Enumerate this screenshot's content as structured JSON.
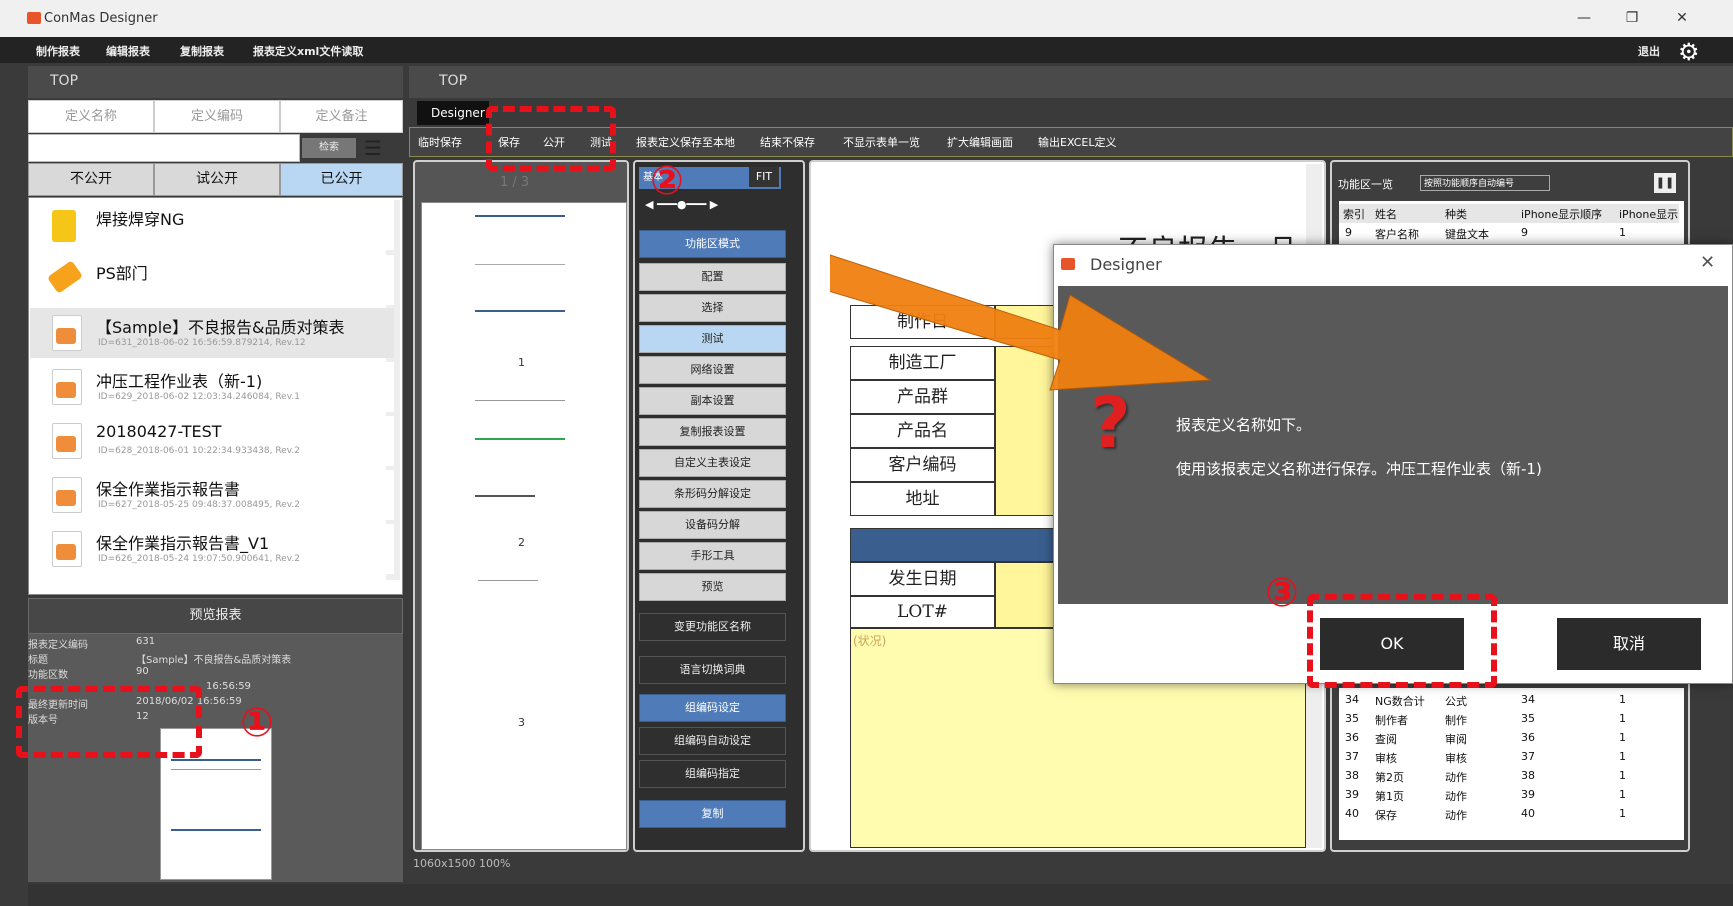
{
  "window": {
    "title": "ConMas Designer",
    "min": "—",
    "restore": "❐",
    "close": "✕"
  },
  "menu": [
    "制作报表",
    "编辑报表",
    "复制报表",
    "报表定义xml文件读取"
  ],
  "menu_right": "退出",
  "left": {
    "top_label": "TOP",
    "columns": [
      "定义名称",
      "定义编码",
      "定义备注"
    ],
    "search_btn": "检索",
    "filters": [
      "不公开",
      "试公开",
      "已公开"
    ],
    "items": [
      {
        "name": "焊接焊穿NG",
        "sub": "",
        "kind": "folder"
      },
      {
        "name": "PS部门",
        "sub": "",
        "kind": "tag"
      },
      {
        "name": "【Sample】不良报告&品质对策表",
        "sub": "ID=631_2018-06-02 16:56:59.879214, Rev.12",
        "kind": "file"
      },
      {
        "name": "冲压工程作业表（新-1)",
        "sub": "ID=629_2018-06-02 12:03:34.246084, Rev.1",
        "kind": "file"
      },
      {
        "name": "20180427-TEST",
        "sub": "ID=628_2018-06-01 10:22:34.933438, Rev.2",
        "kind": "file"
      },
      {
        "name": "保全作業指示報告書",
        "sub": "ID=627_2018-05-25 09:48:37.008495, Rev.2",
        "kind": "file"
      },
      {
        "name": "保全作業指示報告書_V1",
        "sub": "ID=626_2018-05-24 19:07:50.900641, Rev.2",
        "kind": "file"
      }
    ],
    "preview_title": "预览报表",
    "info": [
      {
        "k": "报表定义编码",
        "v": "631"
      },
      {
        "k": "标题",
        "v": "【Sample】不良报告&品质对策表"
      },
      {
        "k": "功能区数",
        "v": "90"
      },
      {
        "k": "",
        "v": "16:56:59"
      },
      {
        "k": "最终更新时间",
        "v": "2018/06/02 16:56:59"
      },
      {
        "k": "版本号",
        "v": "12"
      }
    ]
  },
  "right": {
    "top_label": "TOP",
    "tab": "Designer",
    "toolbar": [
      "临时保存",
      "保存",
      "公开",
      "测试",
      "报表定义保存至本地",
      "结束不保存",
      "不显示表单一览",
      "扩大编辑画面",
      "输出EXCEL定义"
    ],
    "thumb_header": "1 / 3",
    "page_labels": [
      "1",
      "2",
      "3"
    ],
    "status": "1060x1500 100%",
    "mid_header": "基本",
    "fit": "FIT",
    "mode_btn": "功能区模式",
    "buttons": [
      {
        "label": "配置",
        "style": "normal"
      },
      {
        "label": "选择",
        "style": "normal"
      },
      {
        "label": "测试",
        "style": "sel"
      },
      {
        "label": "网络设置",
        "style": "normal"
      },
      {
        "label": "副本设置",
        "style": "normal"
      },
      {
        "label": "复制报表设置",
        "style": "normal"
      },
      {
        "label": "自定义主表设定",
        "style": "normal"
      },
      {
        "label": "条形码分解设定",
        "style": "normal"
      },
      {
        "label": "设备码分解",
        "style": "normal"
      },
      {
        "label": "手形工具",
        "style": "normal"
      },
      {
        "label": "预览",
        "style": "normal"
      }
    ],
    "buttons2": [
      {
        "label": "变更功能区名称",
        "style": "dark"
      },
      {
        "label": "语言切换词典",
        "style": "dark"
      },
      {
        "label": "组编码设定",
        "style": "blue"
      },
      {
        "label": "组编码自动设定",
        "style": "dark"
      },
      {
        "label": "组编码指定",
        "style": "dark"
      },
      {
        "label": "复制",
        "style": "blue"
      }
    ],
    "form_title": "不良报告・品",
    "form_labels": [
      "制作日",
      "制造工厂",
      "产品群",
      "产品名",
      "客户编码",
      "地址"
    ],
    "form_labels2": [
      "发生日期",
      "LOT#"
    ],
    "form_note": "(状况)",
    "table": {
      "title": "功能区一览",
      "btn": "按照功能顺序自动编号",
      "headers": [
        "索引",
        "姓名",
        "种类",
        "iPhone显示顺序",
        "iPhone显示"
      ],
      "top_rows": [
        [
          "9",
          "客户名称",
          "键盘文本",
          "9",
          "1"
        ],
        [
          "10",
          "",
          "",
          "",
          ""
        ]
      ],
      "rows": [
        [
          "34",
          "NG数合计",
          "公式",
          "34",
          "1"
        ],
        [
          "35",
          "制作者",
          "制作",
          "35",
          "1"
        ],
        [
          "36",
          "查阅",
          "审阅",
          "36",
          "1"
        ],
        [
          "37",
          "审核",
          "审核",
          "37",
          "1"
        ],
        [
          "38",
          "第2页",
          "动作",
          "38",
          "1"
        ],
        [
          "39",
          "第1页",
          "动作",
          "39",
          "1"
        ],
        [
          "40",
          "保存",
          "动作",
          "40",
          "1"
        ]
      ]
    }
  },
  "dialog": {
    "title": "Designer",
    "close": "✕",
    "icon": "?",
    "line1": "报表定义名称如下。",
    "line2": "使用该报表定义名称进行保存。冲压工程作业表（新-1)",
    "ok": "OK",
    "cancel": "取消"
  },
  "callouts": [
    "①",
    "②",
    "③"
  ],
  "colors": {
    "callout": "#e8101a",
    "arrow": "#f08010",
    "dialog_bg": "#595959",
    "accent": "#4f7cb8"
  }
}
